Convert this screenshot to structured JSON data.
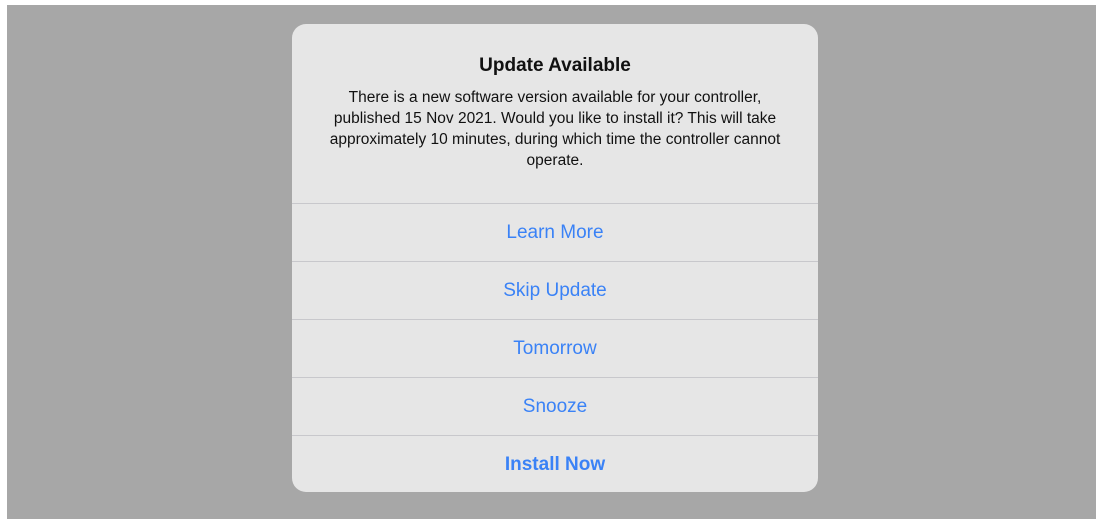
{
  "alert": {
    "title": "Update Available",
    "message": "There is a new software version available for your controller, published 15 Nov 2021. Would you like to install it? This will take approximately 10 minutes, during which time the controller cannot operate.",
    "actions": [
      {
        "label": "Learn More"
      },
      {
        "label": "Skip Update"
      },
      {
        "label": "Tomorrow"
      },
      {
        "label": "Snooze"
      },
      {
        "label": "Install Now"
      }
    ]
  },
  "colors": {
    "backdrop": "#a7a7a7",
    "alert_background": "#e6e6e6",
    "action_text": "#3a82f6",
    "separator": "#c8c8cc"
  }
}
